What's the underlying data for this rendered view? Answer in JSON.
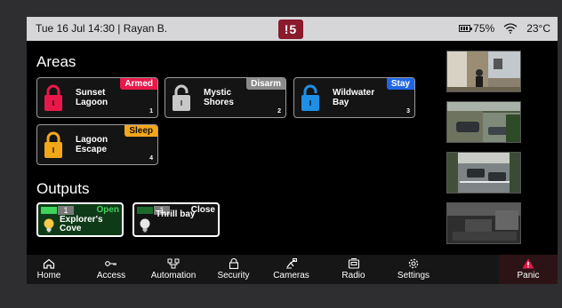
{
  "status": {
    "datetime_user": "Tue 16 Jul 14:30 | Rayan B.",
    "alert_badge": "!5",
    "battery": "75%",
    "temperature": "23°C"
  },
  "areas": {
    "title": "Areas",
    "items": [
      {
        "name_line1": "Sunset",
        "name_line2": "Lagoon",
        "badge": "Armed",
        "number": "1",
        "lock_color": "#e8194a",
        "badge_color": "#e8194a"
      },
      {
        "name_line1": "Mystic",
        "name_line2": "Shores",
        "badge": "Disarm",
        "number": "2",
        "lock_color": "#c8c8c8",
        "badge_color": "#8a8a8a"
      },
      {
        "name_line1": "Wildwater",
        "name_line2": "Bay",
        "badge": "Stay",
        "number": "3",
        "lock_color": "#1f8fe6",
        "badge_color": "#1f66e6"
      },
      {
        "name_line1": "Lagoon",
        "name_line2": "Escape",
        "badge": "Sleep",
        "number": "4",
        "lock_color": "#f2a71b",
        "badge_color": "#f2a71b"
      }
    ]
  },
  "outputs": {
    "title": "Outputs",
    "items": [
      {
        "number": "1",
        "state": "Open",
        "name_line1": "Explorer's",
        "name_line2": "Cove",
        "bg_color": "#0f3a18",
        "state_color": "#3fd35a"
      },
      {
        "number": "1",
        "state": "Close",
        "name_line1": "Thrill bay",
        "name_line2": "",
        "bg_color": "#121212",
        "state_color": "#ffffff"
      }
    ]
  },
  "cameras": [
    "camera-front-door",
    "camera-driveway",
    "camera-parking",
    "camera-backyard-night"
  ],
  "nav": {
    "items": [
      {
        "label": "Home",
        "icon": "home-icon"
      },
      {
        "label": "Access",
        "icon": "key-icon"
      },
      {
        "label": "Automation",
        "icon": "automation-icon"
      },
      {
        "label": "Security",
        "icon": "security-icon"
      },
      {
        "label": "Cameras",
        "icon": "camera-icon"
      },
      {
        "label": "Radio",
        "icon": "radio-icon"
      },
      {
        "label": "Settings",
        "icon": "gear-icon"
      }
    ],
    "panic_label": "Panic",
    "panic_color": "#e8194a"
  }
}
